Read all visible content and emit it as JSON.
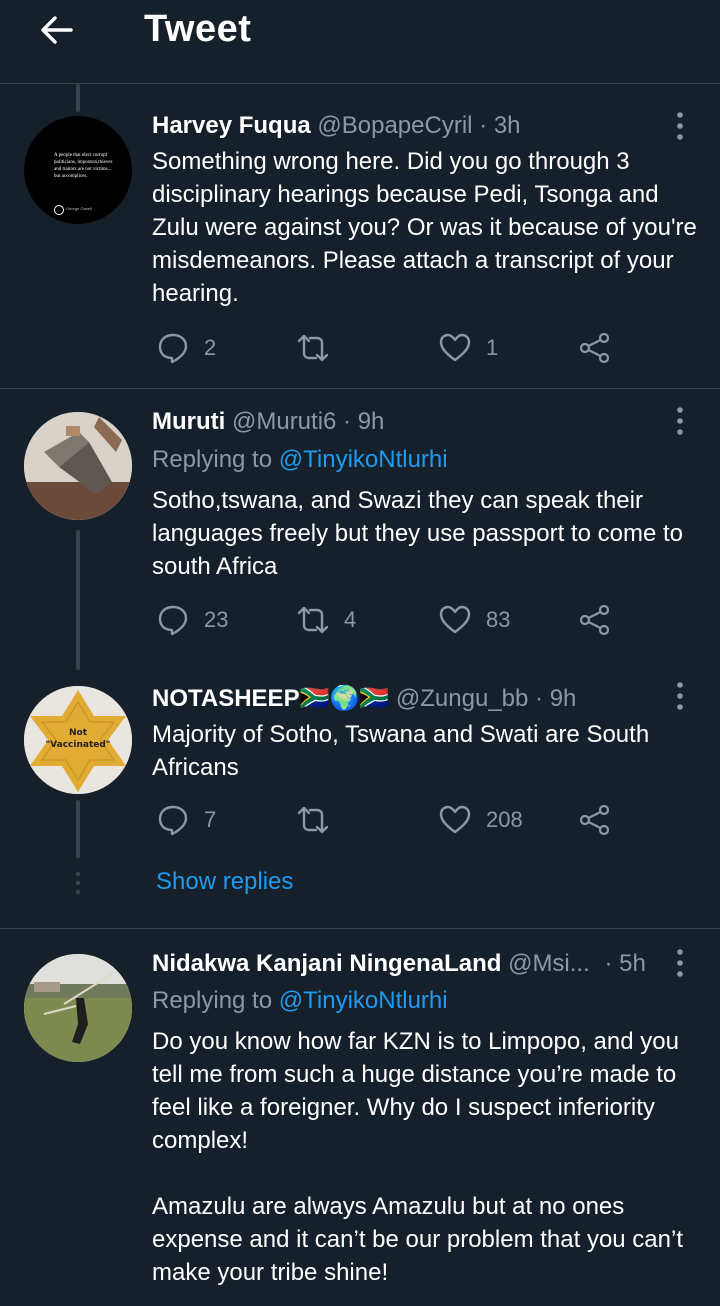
{
  "header": {
    "title": "Tweet",
    "back_icon": "arrow-left-icon"
  },
  "tweets": [
    {
      "name": "Harvey Fuqua",
      "handle": "@BopapeCyril",
      "time": "· 3h",
      "text": "Something wrong here. Did you go through 3 disciplinary hearings because Pedi, Tsonga and Zulu were against you? Or was it because of you're misdemeanors. Please attach a transcript of your hearing.",
      "avatar_text": "A people that elect corrupt politicians, impostors,thieves and traitors are not victims... but accomplices.",
      "avatar_caption": "George Orwell",
      "replies": "2",
      "retweets": "",
      "likes": "1"
    },
    {
      "name": "Muruti",
      "handle": "@Muruti6",
      "time": "· 9h",
      "replying_prefix": "Replying to ",
      "replying_to": "@TinyikoNtlurhi",
      "text": "Sotho,tswana, and Swazi they can speak their languages freely but they use passport to come to south Africa",
      "replies": "23",
      "retweets": "4",
      "likes": "83"
    },
    {
      "name": "NOTASHEEP🇿🇦🌍🇿🇦",
      "handle": "@Zungu_bb",
      "time": "· 9h",
      "text": "Majority of Sotho, Tswana and Swati are South Africans",
      "avatar_line1": "Not",
      "avatar_line2": "\"Vaccinated\"",
      "replies": "7",
      "retweets": "",
      "likes": "208",
      "show_replies": "Show replies"
    },
    {
      "name": "Nidakwa Kanjani NingenaLand",
      "handle": "@Msi...",
      "time": "· 5h",
      "replying_prefix": "Replying to ",
      "replying_to": "@TinyikoNtlurhi",
      "text_p1": "Do you know how far KZN is to Limpopo, and you tell me from such a huge distance you’re made to feel like a foreigner. Why do I suspect inferiority complex!",
      "text_p2": "Amazulu are always Amazulu but at no ones expense and it can’t be our problem that you can’t make your tribe shine!"
    }
  ],
  "colors": {
    "background": "#15202b",
    "accent": "#1d9bf0",
    "muted": "#8b98a5",
    "border": "#38444d"
  }
}
